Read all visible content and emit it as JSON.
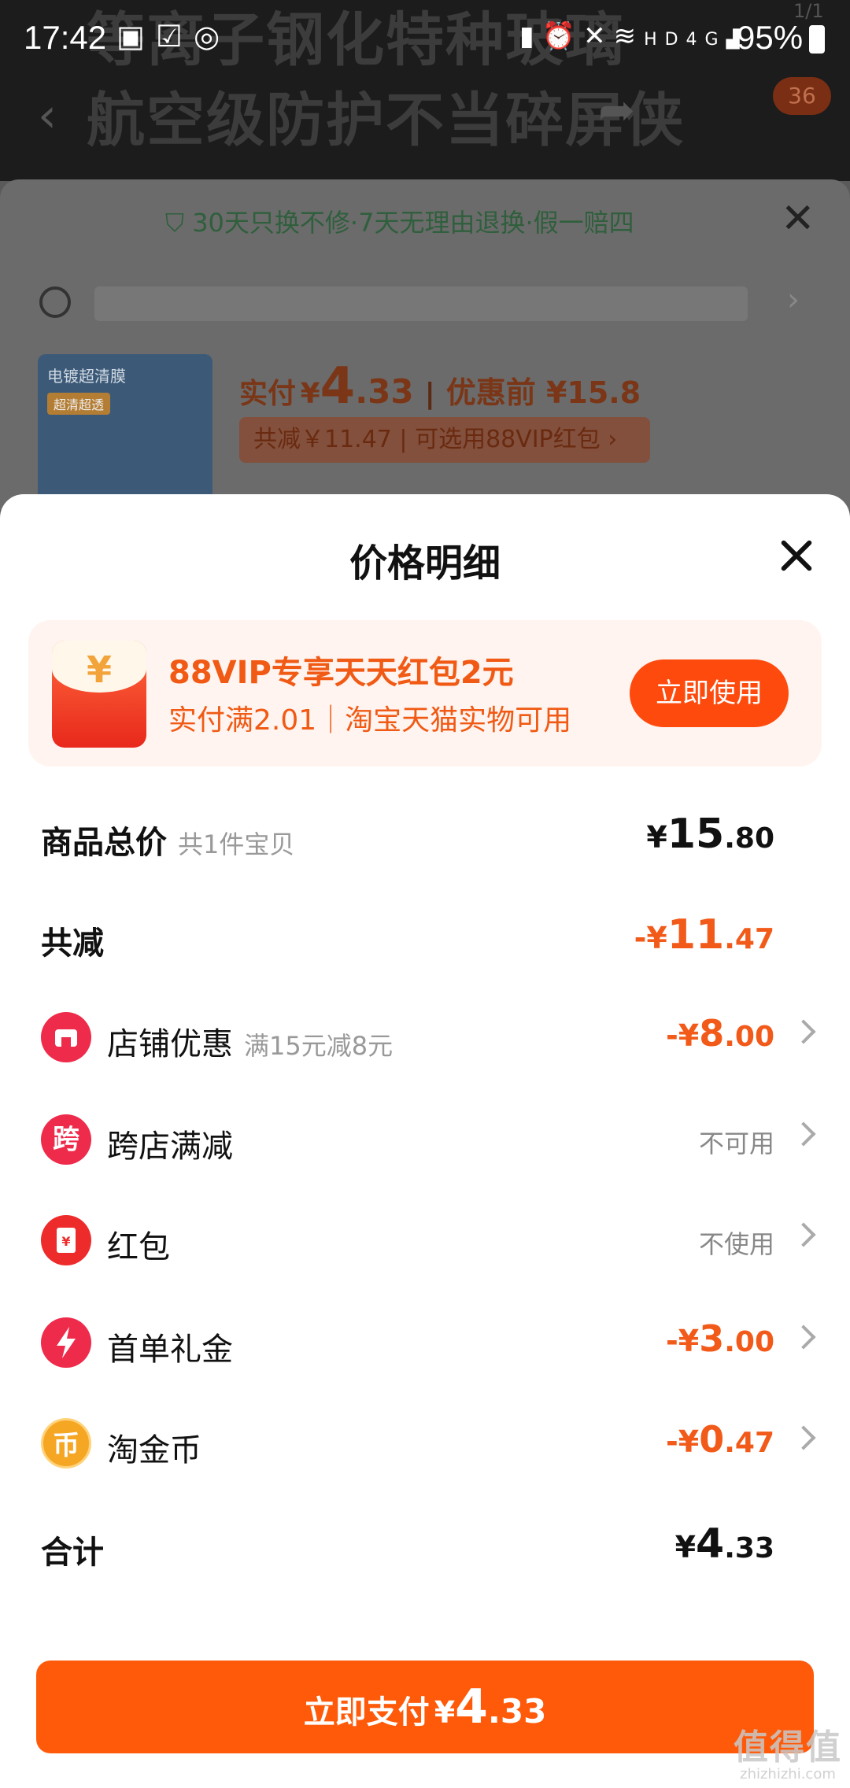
{
  "status_bar": {
    "time": "17:42",
    "left_icons": [
      "image-icon",
      "check-icon",
      "compass-icon"
    ],
    "right_icons": [
      "battery-saver-icon",
      "alarm-icon",
      "mute-icon",
      "wifi-icon",
      "hd-icon",
      "signal-4g-icon"
    ],
    "hd_label": "HD",
    "network_label": "4G",
    "battery": "95%"
  },
  "background_page": {
    "banner_line1": "等离子钢化特种玻璃",
    "banner_line2": "航空级防护不当碎屏侠",
    "pager": "1/1",
    "cart_badge": "36",
    "guarantee": "30天只换不修·7天无理由退换·假一赔四",
    "thumbnail_title": "电镀超清膜",
    "thumbnail_tag": "超清超透",
    "pay_label": "实付",
    "pay_currency": "¥",
    "pay_int": "4",
    "pay_dec": ".33",
    "before_discount": "优惠前 ¥15.8",
    "savings": "共减￥11.47 | 可选用88VIP红包 ›"
  },
  "sheet": {
    "title": "价格明细",
    "promo": {
      "title": "88VIP专享天天红包2元",
      "subtitle": "实付满2.01｜淘宝天猫实物可用",
      "icon_text": "¥",
      "button": "立即使用"
    },
    "total_price": {
      "label": "商品总价",
      "sub": "共1件宝贝",
      "sign": "¥",
      "int": "15",
      "dec": ".80"
    },
    "total_discount": {
      "label": "共减",
      "sign": "-¥",
      "int": "11",
      "dec": ".47"
    },
    "discounts": [
      {
        "label": "店铺优惠",
        "sub": "满15元减8元",
        "icon": "store-icon",
        "icon_color": "#ee2b4b",
        "sign": "-¥",
        "int": "8",
        "dec": ".00"
      },
      {
        "label": "跨店满减",
        "icon": "cross-store-icon",
        "icon_text": "跨",
        "icon_color": "#ee2b4b",
        "status": "不可用"
      },
      {
        "label": "红包",
        "icon": "red-envelope-icon",
        "icon_text": "¥",
        "icon_color": "#ee2b2b",
        "status": "不使用"
      },
      {
        "label": "首单礼金",
        "icon": "lightning-icon",
        "icon_color": "#ee2b4b",
        "sign": "-¥",
        "int": "3",
        "dec": ".00"
      },
      {
        "label": "淘金币",
        "icon": "gold-coin-icon",
        "icon_text": "币",
        "icon_color": "#f5a623",
        "sign": "-¥",
        "int": "0",
        "dec": ".47"
      }
    ],
    "subtotal": {
      "label": "合计",
      "sign": "¥",
      "int": "4",
      "dec": ".33"
    },
    "pay_button": {
      "label": "立即支付",
      "currency": "¥",
      "int": "4",
      "dec": ".33"
    }
  },
  "watermark": {
    "text": "值得值",
    "url": "zhizhizhi.com"
  },
  "colors": {
    "accent": "#ff5a0a",
    "discount_text": "#f25a1a",
    "promo_bg": "#fff4f0"
  }
}
